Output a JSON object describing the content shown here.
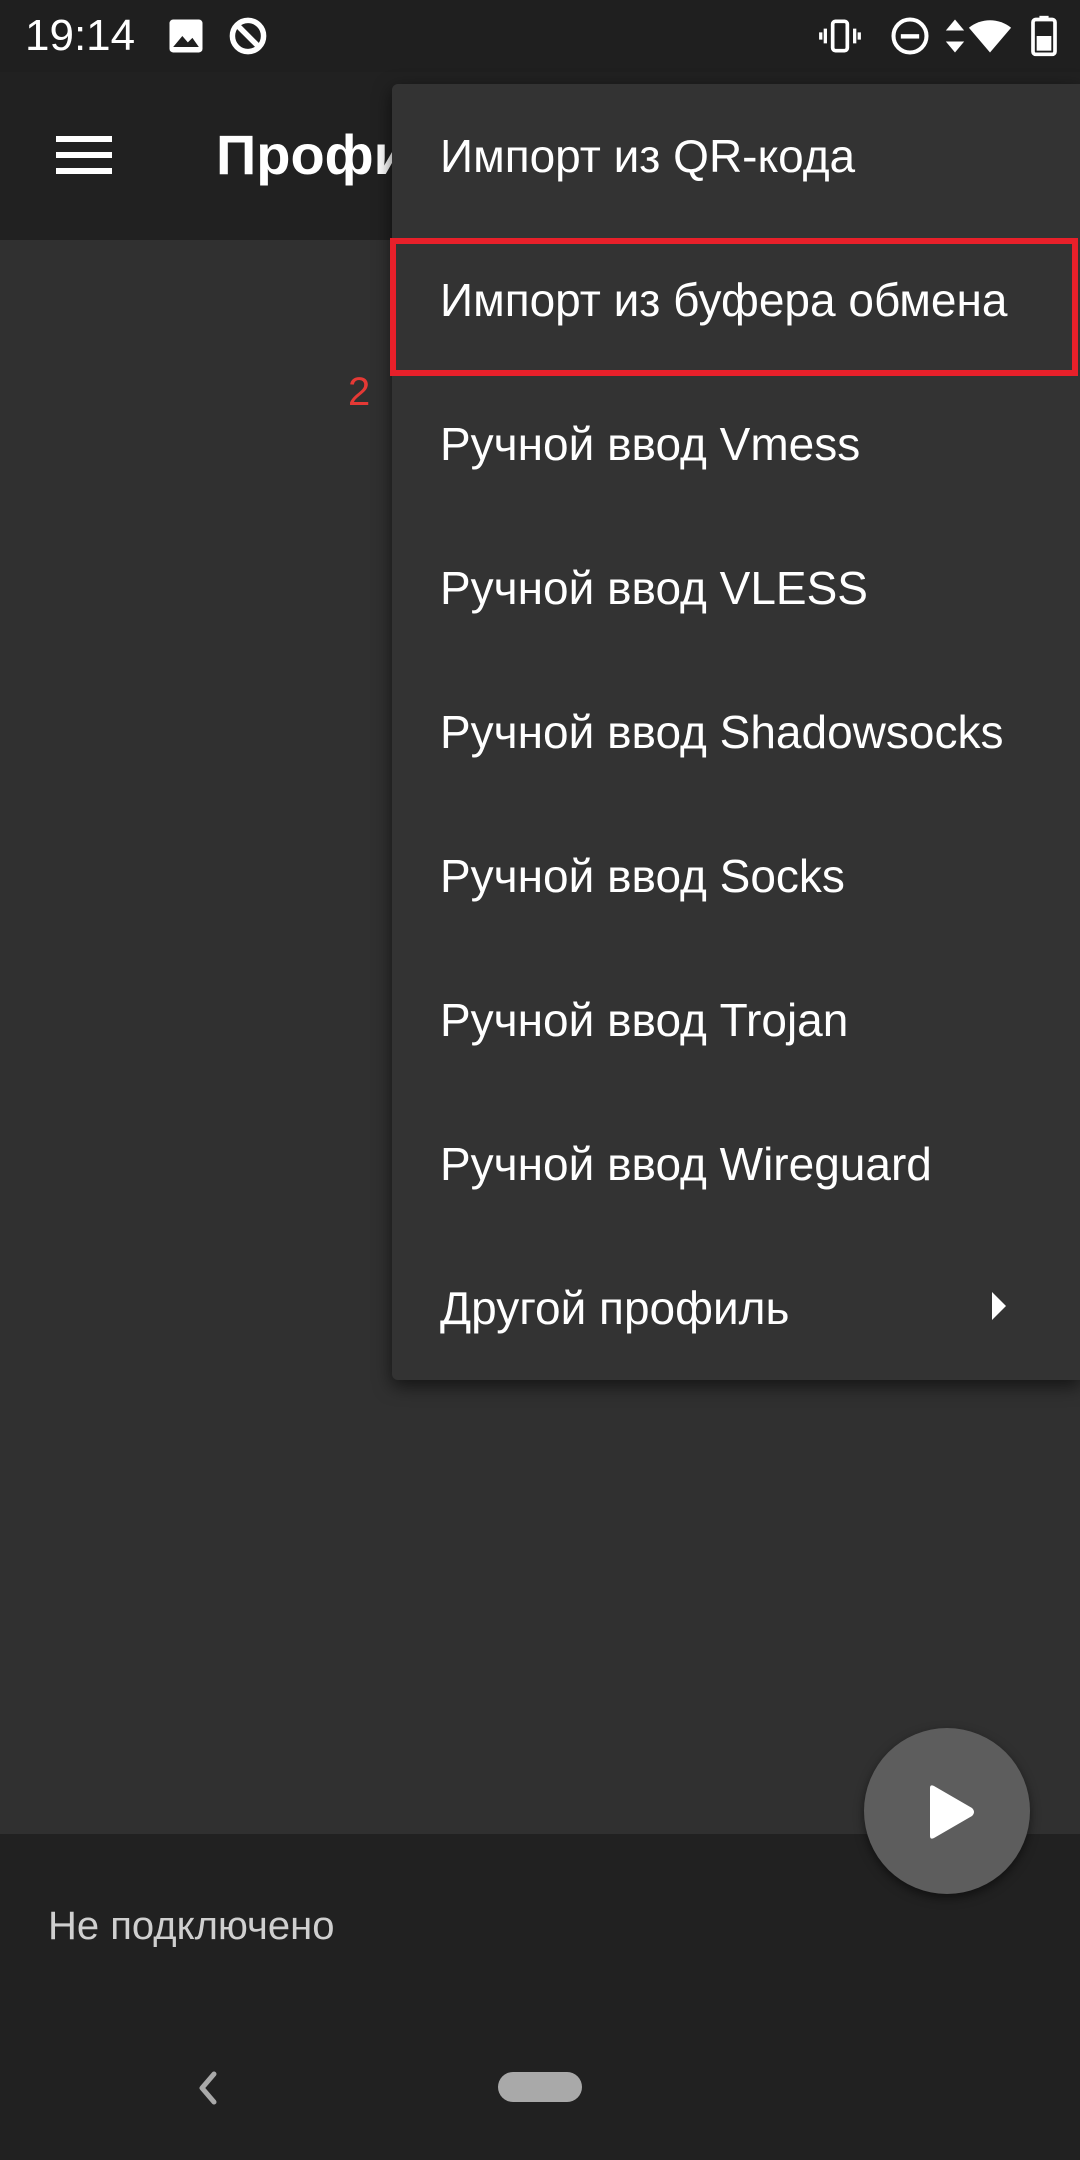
{
  "status_bar": {
    "time": "19:14",
    "icons": [
      "image-icon",
      "data-saver-icon",
      "vibrate-icon",
      "do-not-disturb-icon",
      "data-arrows-icon",
      "wifi-icon",
      "battery-icon"
    ]
  },
  "app_bar": {
    "title": "Профили",
    "menu_icon": "hamburger-menu-icon"
  },
  "annotation": {
    "step_number": "2",
    "highlight_color": "#e8202a"
  },
  "popup_menu": {
    "items": [
      {
        "label": "Импорт из QR-кода"
      },
      {
        "label": "Импорт из буфера обмена",
        "highlighted": true
      },
      {
        "label": "Ручной ввод Vmess"
      },
      {
        "label": "Ручной ввод VLESS"
      },
      {
        "label": "Ручной ввод Shadowsocks"
      },
      {
        "label": "Ручной ввод Socks"
      },
      {
        "label": "Ручной ввод Trojan"
      },
      {
        "label": "Ручной ввод Wireguard"
      },
      {
        "label": "Другой профиль",
        "has_submenu": true
      }
    ]
  },
  "bottom": {
    "connection_status": "Не подключено"
  },
  "fab": {
    "icon": "play-icon"
  },
  "colors": {
    "background": "#303030",
    "app_bar": "#212121",
    "menu_background": "#333333",
    "fab": "#5d5d5d"
  }
}
